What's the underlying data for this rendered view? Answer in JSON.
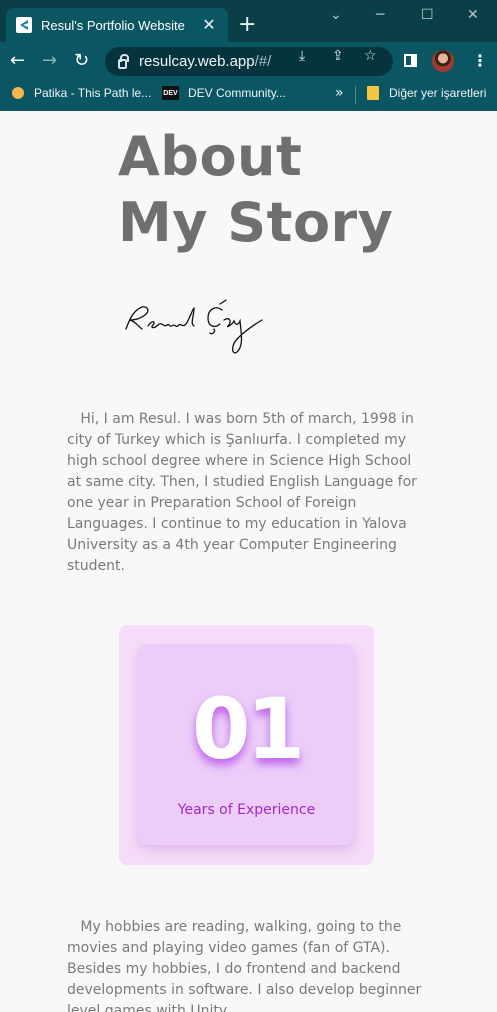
{
  "browser": {
    "tab_title": "Resul's Portfolio Website",
    "tab_close": "✕",
    "new_tab": "+",
    "url_host": "resulcay.web.app",
    "url_rest": "/#/",
    "bookmarks": [
      {
        "label": "Patika - This Path le...",
        "icon": "patika-icon"
      },
      {
        "label": "DEV Community...",
        "icon": "dev-icon"
      }
    ],
    "bookmarks_more": "»",
    "other_bookmarks": "Diğer yer işaretleri",
    "dev_badge": "DEV",
    "accent": "#0b5663"
  },
  "page": {
    "heading_line1": "About",
    "heading_line2": "My Story",
    "signature": "Resul Çay",
    "paragraph1": "Hi, I am Resul. I was born  5th of march, 1998 in city of Turkey which is Şanlıurfa. I completed my high school degree where in Science High School at same city. Then, I studied English Language for one year in Preparation School of Foreign Languages. I continue to my education in Yalova University as a 4th year Computer Engineering student.",
    "experience_years": "01",
    "experience_label": "Years of Experience",
    "paragraph2": "My hobbies are reading, walking, going to the movies and playing video games (fan of GTA). Besides my hobbies, I do frontend and backend developments in software. I also develop beginner level games with Unity.",
    "card_color": "#ebcdf8",
    "label_color": "#a427c9"
  }
}
